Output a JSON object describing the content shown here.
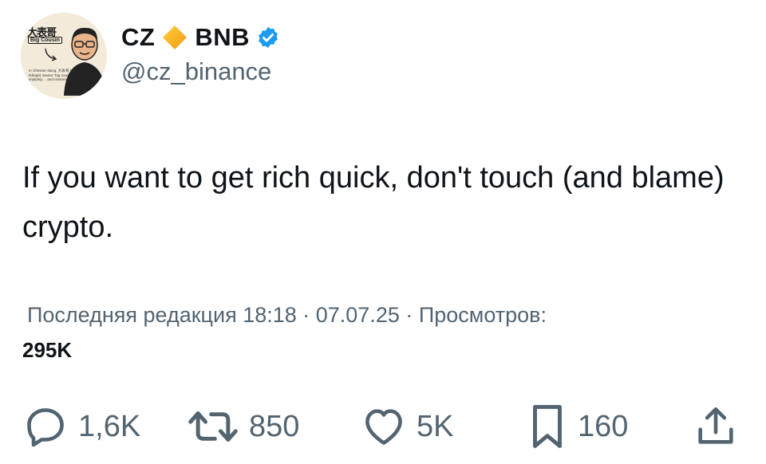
{
  "author": {
    "name": "CZ",
    "brand": "BNB",
    "handle": "@cz_binance",
    "avatar": {
      "title_cn": "大表哥",
      "title_en": "Big Cousin",
      "caption": "In Chinese slang, 大表哥 (dà biǎogē) means \"big cousin,\" implying ... and closeness."
    }
  },
  "tweet": {
    "text": "If you want to get rich quick, don't touch (and blame) crypto."
  },
  "meta": {
    "line": "Последняя редакция 18:18 · 07.07.25 · Просмотров:",
    "views": "295K"
  },
  "actions": {
    "replies": "1,6K",
    "reposts": "850",
    "likes": "5K",
    "bookmarks": "160"
  },
  "colors": {
    "text": "#0f1419",
    "secondary": "#536471",
    "verified": "#1d9bf0",
    "bnb": "#f3ba2f"
  },
  "icons": [
    "bnb-diamond-icon",
    "verified-badge-icon",
    "reply-icon",
    "repost-icon",
    "like-icon",
    "bookmark-icon",
    "share-icon"
  ]
}
